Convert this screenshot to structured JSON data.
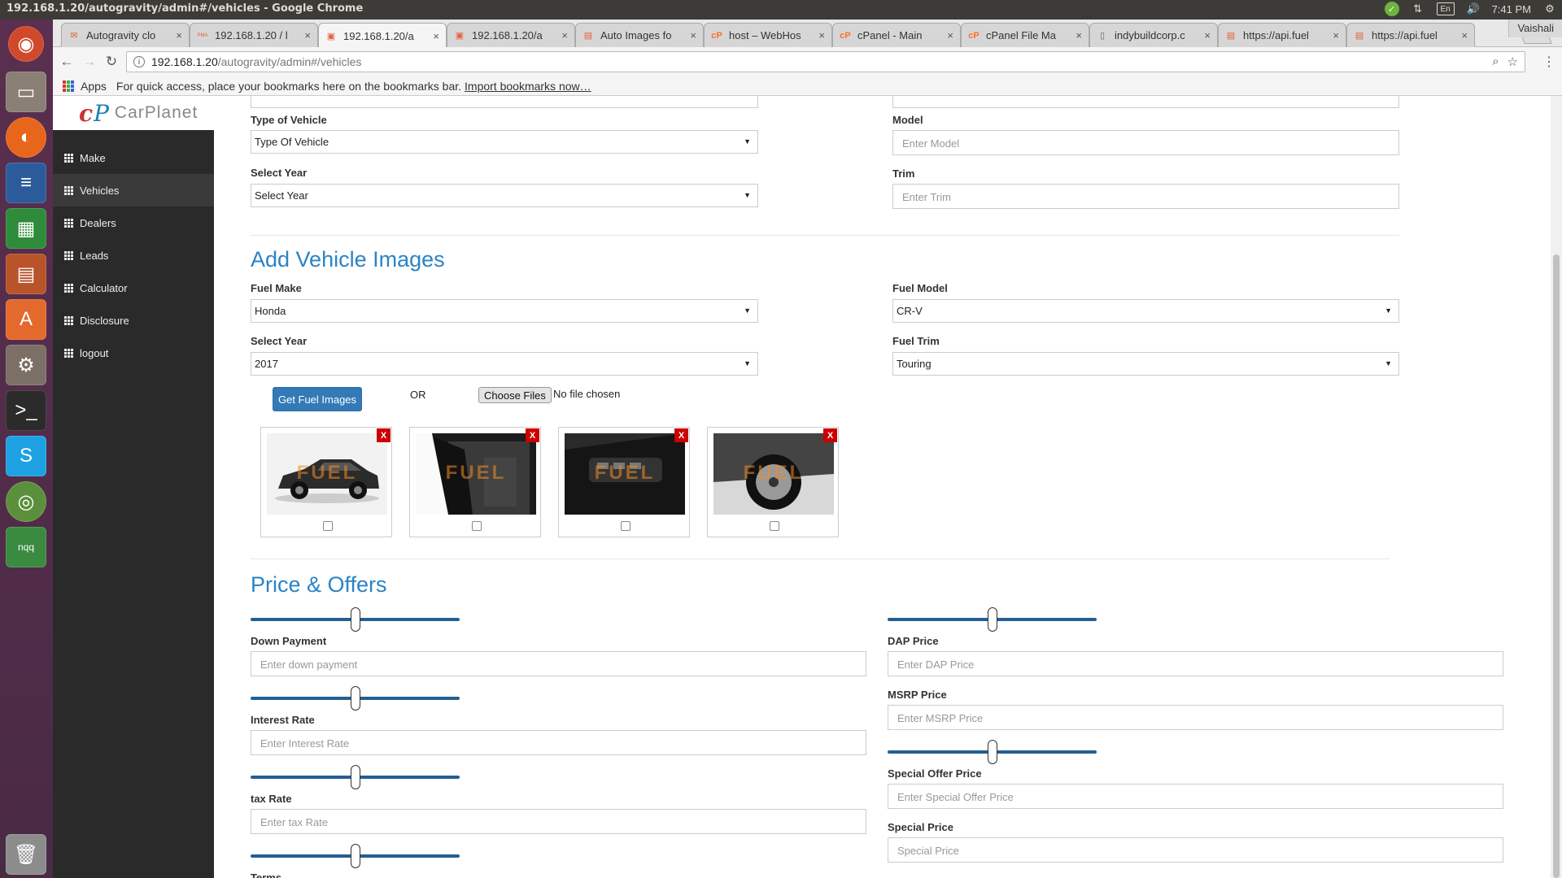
{
  "os": {
    "window_title": "192.168.1.20/autogravity/admin#/vehicles - Google Chrome",
    "lang": "En",
    "time": "7:41 PM",
    "user": "Vaishali"
  },
  "launcher": [
    "ubuntu-icon",
    "files-icon",
    "firefox-icon",
    "writer-icon",
    "calc-icon",
    "impress-icon",
    "software-center-icon",
    "settings-icon",
    "terminal-icon",
    "skype-icon",
    "chrome-icon",
    "nqq-icon",
    "trash-icon"
  ],
  "browser": {
    "tabs": [
      {
        "title": "Autogravity clo",
        "icon": "mail-icon"
      },
      {
        "title": "192.168.1.20 / l",
        "icon": "pma-icon"
      },
      {
        "title": "192.168.1.20/a",
        "icon": "image-icon"
      },
      {
        "title": "192.168.1.20/a",
        "icon": "image-icon"
      },
      {
        "title": "Auto Images fo",
        "icon": "pdf-icon"
      },
      {
        "title": "host – WebHos",
        "icon": "cpanel-icon"
      },
      {
        "title": "cPanel - Main",
        "icon": "cpanel-icon"
      },
      {
        "title": "cPanel File Ma",
        "icon": "cpanel-icon"
      },
      {
        "title": "indybuildcorp.c",
        "icon": "doc-icon"
      },
      {
        "title": "https://api.fuel",
        "icon": "pdf-icon"
      },
      {
        "title": "https://api.fuel",
        "icon": "pdf-icon"
      }
    ],
    "active_tab": 2,
    "url_host": "192.168.1.20",
    "url_path": "/autogravity/admin#/vehicles",
    "bookmarks_apps": "Apps",
    "bookmarks_hint": "For quick access, place your bookmarks here on the bookmarks bar.",
    "bookmarks_import": "Import bookmarks now…"
  },
  "app": {
    "brand": "CarPlanet",
    "sidebar": [
      {
        "label": "Make"
      },
      {
        "label": "Vehicles"
      },
      {
        "label": "Dealers"
      },
      {
        "label": "Leads"
      },
      {
        "label": "Calculator"
      },
      {
        "label": "Disclosure"
      },
      {
        "label": "logout"
      }
    ],
    "active_sidebar": 1
  },
  "form": {
    "top": {
      "type_label": "Type of Vehicle",
      "type_value": "Type Of Vehicle",
      "model_label": "Model",
      "model_placeholder": "Enter Model",
      "year_label": "Select Year",
      "year_value": "Select Year",
      "trim_label": "Trim",
      "trim_placeholder": "Enter Trim"
    },
    "images": {
      "heading": "Add Vehicle Images",
      "fuel_make_label": "Fuel Make",
      "fuel_make_value": "Honda",
      "fuel_model_label": "Fuel Model",
      "fuel_model_value": "CR-V",
      "year_label": "Select Year",
      "year_value": "2017",
      "fuel_trim_label": "Fuel Trim",
      "fuel_trim_value": "Touring",
      "get_button": "Get Fuel Images",
      "or_text": "OR",
      "choose_files": "Choose Files",
      "no_file": "No file chosen",
      "delete_label": "X",
      "watermark": "FUEL",
      "cards": [
        {
          "view": "exterior side view",
          "bg": "#f2f2f2"
        },
        {
          "view": "open door interior",
          "bg": "#1c1c1c"
        },
        {
          "view": "door panel controls",
          "bg": "#2a2a2a"
        },
        {
          "view": "wheel close-up",
          "bg": "#d8d8d8"
        }
      ]
    },
    "price": {
      "heading": "Price & Offers",
      "down_payment_label": "Down Payment",
      "down_payment_placeholder": "Enter down payment",
      "interest_label": "Interest Rate",
      "interest_placeholder": "Enter Interest Rate",
      "tax_label": "tax Rate",
      "tax_placeholder": "Enter tax Rate",
      "terms_label": "Terms",
      "dap_label": "DAP Price",
      "dap_placeholder": "Enter DAP Price",
      "msrp_label": "MSRP Price",
      "msrp_placeholder": "Enter MSRP Price",
      "special_offer_label": "Special Offer Price",
      "special_offer_placeholder": "Enter Special Offer Price",
      "special_label": "Special Price",
      "special_placeholder": "Special Price",
      "slider_level": 0.5
    }
  },
  "colors": {
    "accent": "#2b83c6",
    "button": "#337ab7",
    "slider_track": "#235f92",
    "sidebar": "#2a2a2a",
    "delete": "#cc0000"
  }
}
